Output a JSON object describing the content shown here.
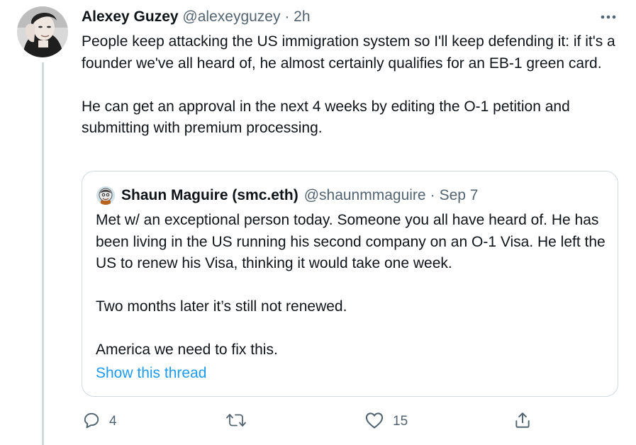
{
  "tweet": {
    "author_name": "Alexey Guzey",
    "author_handle": "@alexeyguzey",
    "separator": "·",
    "time": "2h",
    "text": "People keep attacking the US immigration system so I'll keep defending it: if it's a founder we've all heard of, he almost certainly qualifies for an EB-1 green card.\n\nHe can get an approval in the next 4 weeks by editing the O-1 petition and submitting with premium processing."
  },
  "quoted_tweet": {
    "author_name": "Shaun Maguire (smc.eth)",
    "author_handle": "@shaunmmaguire",
    "separator": "·",
    "date": "Sep 7",
    "text": "Met w/ an exceptional person today. Someone you all have heard of. He has been living in the US running his second company on an O-1 Visa. He left the US to renew his Visa, thinking it would take one week.\n\nTwo months later it’s still not renewed.\n\nAmerica we need to fix this.",
    "show_thread_label": "Show this thread"
  },
  "actions": {
    "replies": "4",
    "retweets": "",
    "likes": "15"
  },
  "icons": {
    "more": "more-horizontal-icon",
    "reply": "reply-bubble-icon",
    "retweet": "retweet-icon",
    "like": "heart-icon",
    "share": "share-icon"
  },
  "colors": {
    "link": "#1d9bf0",
    "muted": "#536471",
    "text": "#0f1419",
    "border": "#cfd9de"
  }
}
